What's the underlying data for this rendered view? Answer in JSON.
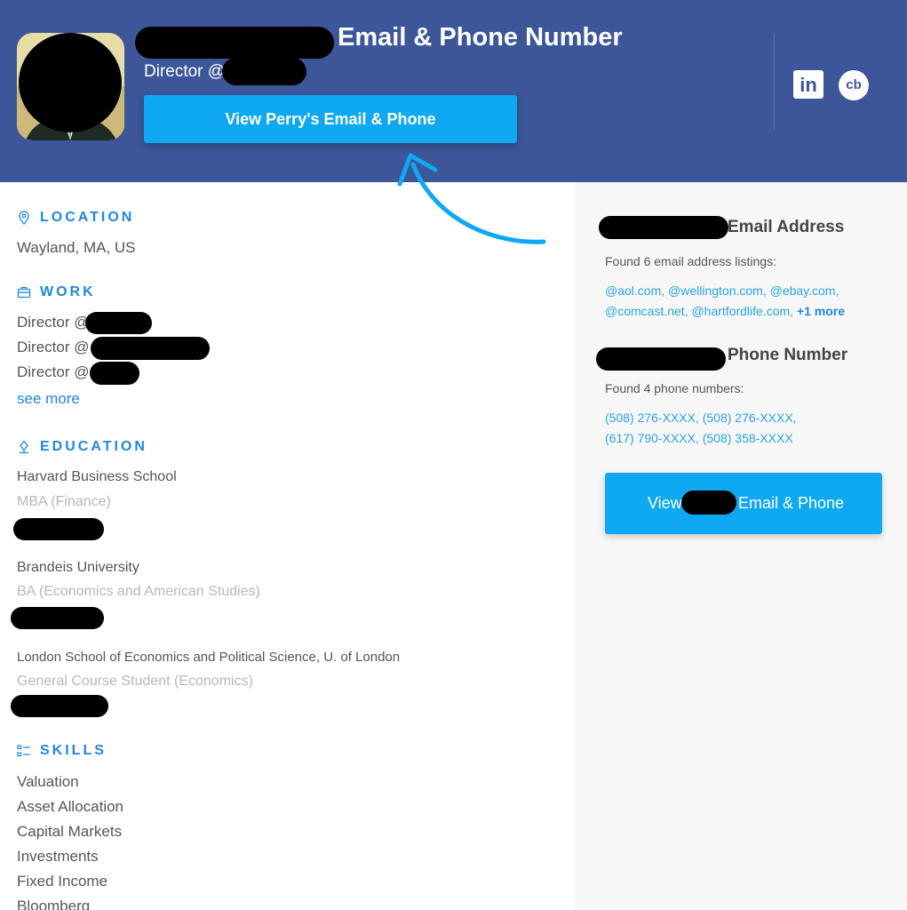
{
  "header": {
    "title_suffix": "Email & Phone Number",
    "subtitle": "Director @",
    "view_button": "View Perry's Email & Phone",
    "linkedin_icon": "linkedin-icon",
    "crunchbase_icon": "crunchbase-icon",
    "linkedin_text": "in",
    "crunchbase_text": "cb",
    "bg_color": "#3d569a",
    "button_color": "#0ea8f3"
  },
  "location": {
    "heading": "LOCATION",
    "value": "Wayland, MA, US"
  },
  "work": {
    "heading": "WORK",
    "items": [
      "Director @",
      "Director @",
      "Director @"
    ],
    "see_more": "see more"
  },
  "education": {
    "heading": "EDUCATION",
    "items": [
      {
        "school": "Harvard Business School",
        "degree": "MBA (Finance)"
      },
      {
        "school": "Brandeis University",
        "degree": "BA (Economics and American Studies)"
      },
      {
        "school": "London School of Economics and Political Science, U. of London",
        "degree": "General Course Student (Economics)"
      }
    ]
  },
  "skills": {
    "heading": "SKILLS",
    "items": [
      "Valuation",
      "Asset Allocation",
      "Capital Markets",
      "Investments",
      "Fixed Income",
      "Bloomberg"
    ]
  },
  "email_panel": {
    "heading": "Email Address",
    "found_text": "Found 6 email address listings:",
    "line1": "@aol.com, @wellington.com, @ebay.com,",
    "line2": "@comcast.net, @hartfordlife.com,",
    "more": "+1 more"
  },
  "phone_panel": {
    "heading": "Phone Number",
    "found_text": "Found 4 phone numbers:",
    "line1": "(508) 276-XXXX, (508) 276-XXXX,",
    "line2": "(617) 790-XXXX, (508) 358-XXXX"
  },
  "side_button": {
    "label_start": "View",
    "label_end": "Email & Phone"
  }
}
